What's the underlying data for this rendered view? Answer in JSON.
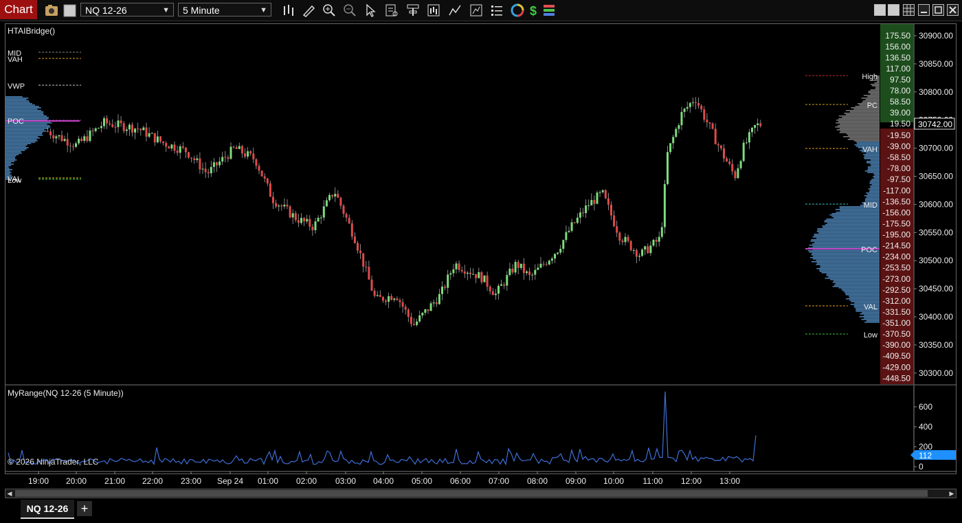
{
  "app": {
    "title": "Chart"
  },
  "toolbar": {
    "instrument": "NQ 12-26",
    "interval": "5 Minute"
  },
  "indicator": {
    "name": "HTAIBridge()"
  },
  "left_profile_labels": [
    "MID",
    "VAH",
    "VWP",
    "POC",
    "VAL",
    "Low"
  ],
  "right_profile_labels": [
    "High",
    "PC",
    "VAH",
    "MID",
    "POC",
    "VAL",
    "Low"
  ],
  "price_axis": {
    "labels": [
      "30900.00",
      "30850.00",
      "30800.00",
      "30750.00",
      "30700.00",
      "30650.00",
      "30600.00",
      "30550.00",
      "30500.00",
      "30450.00",
      "30400.00",
      "30350.00",
      "30300.00"
    ],
    "current_price": "30742.00"
  },
  "offset_ladder": {
    "positive": [
      "175.50",
      "156.00",
      "136.50",
      "117.00",
      "97.50",
      "78.00",
      "58.50",
      "39.00",
      "19.50"
    ],
    "negative": [
      "-19.50",
      "-39.00",
      "-58.50",
      "-78.00",
      "-97.50",
      "-117.00",
      "-136.50",
      "-156.00",
      "-175.50",
      "-195.00",
      "-214.50",
      "-234.00",
      "-253.50",
      "-273.00",
      "-292.50",
      "-312.00",
      "-331.50",
      "-351.00",
      "-370.50",
      "-390.00",
      "-409.50",
      "-429.00",
      "-448.50"
    ]
  },
  "subpanel": {
    "title": "MyRange(NQ 12-26 (5 Minute))",
    "axis_labels": [
      "600",
      "400",
      "200",
      "0"
    ],
    "current_value": "112",
    "copyright": "© 2026 NinjaTrader, LLC"
  },
  "time_axis": {
    "labels": [
      "19:00",
      "20:00",
      "21:00",
      "22:00",
      "23:00",
      "Sep 24",
      "01:00",
      "02:00",
      "03:00",
      "04:00",
      "05:00",
      "06:00",
      "07:00",
      "08:00",
      "09:00",
      "10:00",
      "11:00",
      "12:00",
      "13:00"
    ]
  },
  "tabs": [
    {
      "label": "NQ 12-26"
    }
  ],
  "add_tab_label": "+",
  "colors": {
    "up": "#7ddc7d",
    "down": "#e04a4a",
    "profile": "#4a7fb0",
    "poc": "#c040c0",
    "indicator_line": "#3f6fd6",
    "title_red": "#9e1010",
    "offset_green": "#1f5a1f",
    "offset_red": "#6a1414"
  },
  "icons": [
    "camera-icon",
    "color-swatch-icon",
    "bar-type-icon",
    "drawing-pencil-icon",
    "zoom-in-icon",
    "zoom-out-icon",
    "pointer-icon",
    "data-box-icon",
    "templates-icon",
    "strategies-icon",
    "indicators-icon",
    "properties-icon",
    "chart-trader-icon",
    "global-link-icon",
    "dollar-icon",
    "color-bars-icon"
  ]
}
